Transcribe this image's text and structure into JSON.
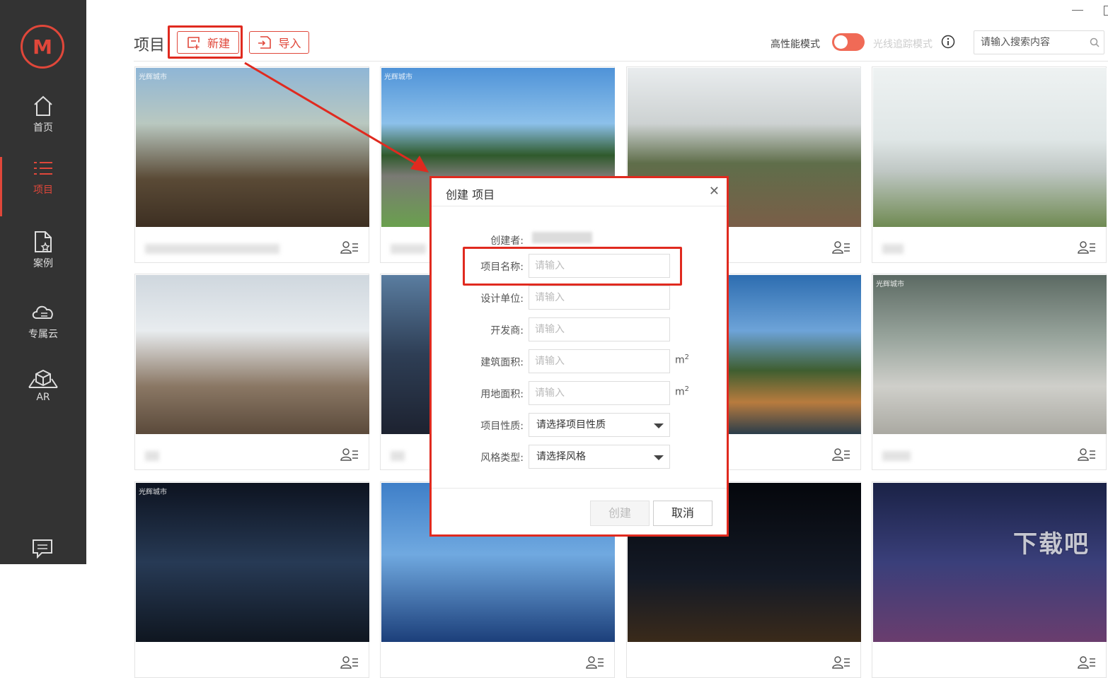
{
  "sidebar": {
    "items": [
      {
        "label": "首页",
        "icon": "home-icon"
      },
      {
        "label": "项目",
        "icon": "list-icon",
        "active": true
      },
      {
        "label": "案例",
        "icon": "doc-star-icon"
      },
      {
        "label": "专属云",
        "icon": "cloud-icon"
      },
      {
        "label": "AR",
        "icon": "cube-icon"
      }
    ]
  },
  "header": {
    "title": "项目",
    "new_label": "新建",
    "import_label": "导入",
    "perf_mode_label": "高性能模式",
    "perf_mode_on": true,
    "ray_mode_label": "光线追踪模式",
    "search_placeholder": "请输入搜索内容"
  },
  "cards": [
    {
      "watermark": "光辉城市"
    },
    {
      "watermark": "光辉城市"
    },
    {
      "watermark": ""
    },
    {
      "watermark": ""
    },
    {
      "watermark": ""
    },
    {
      "watermark": ""
    },
    {
      "watermark": ""
    },
    {
      "watermark": "光辉城市"
    },
    {
      "watermark": "光辉城市"
    },
    {
      "watermark": ""
    },
    {
      "watermark": ""
    },
    {
      "watermark": ""
    }
  ],
  "dialog": {
    "title": "创建 项目",
    "creator_label": "创建者:",
    "fields": {
      "name": {
        "label": "项目名称:",
        "placeholder": "请输入"
      },
      "design_unit": {
        "label": "设计单位:",
        "placeholder": "请输入"
      },
      "developer": {
        "label": "开发商:",
        "placeholder": "请输入"
      },
      "building_area": {
        "label": "建筑面积:",
        "placeholder": "请输入",
        "unit": "m",
        "unit_sup": "2"
      },
      "land_area": {
        "label": "用地面积:",
        "placeholder": "请输入",
        "unit": "m",
        "unit_sup": "2"
      },
      "nature": {
        "label": "项目性质:",
        "value": "请选择项目性质"
      },
      "style": {
        "label": "风格类型:",
        "value": "请选择风格"
      }
    },
    "create_label": "创建",
    "cancel_label": "取消"
  },
  "colors": {
    "accent": "#e0473a",
    "sidebar_bg": "#333333",
    "highlight": "#e02a1f"
  },
  "site_watermark": "下载吧"
}
